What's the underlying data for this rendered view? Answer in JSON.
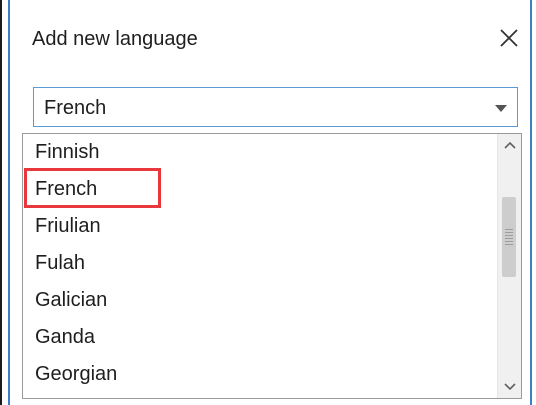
{
  "dialog": {
    "title": "Add new language",
    "close_icon": "close-icon"
  },
  "select": {
    "value": "French",
    "caret_icon": "chevron-down-icon"
  },
  "dropdown": {
    "items": [
      {
        "label": "Finnish"
      },
      {
        "label": "French",
        "highlighted": true
      },
      {
        "label": "Friulian"
      },
      {
        "label": "Fulah"
      },
      {
        "label": "Galician"
      },
      {
        "label": "Ganda"
      },
      {
        "label": "Georgian"
      }
    ],
    "scroll_up_icon": "chevron-up-icon",
    "scroll_down_icon": "chevron-down-icon"
  },
  "colors": {
    "accent": "#3b7fc4",
    "highlight": "#e8383d"
  }
}
